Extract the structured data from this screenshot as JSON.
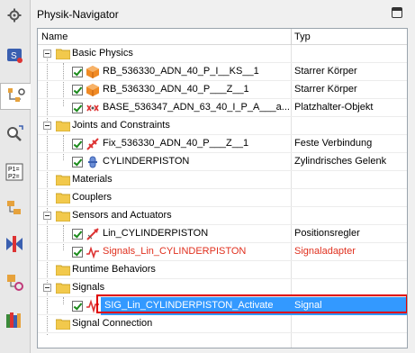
{
  "panel": {
    "title": "Physik-Navigator"
  },
  "tree": {
    "col_name": "Name",
    "col_type": "Typ",
    "rows": [
      {
        "name": "Basic Physics",
        "type": ""
      },
      {
        "name": "RB_536330_ADN_40_P_I__KS__1",
        "type": "Starrer Körper"
      },
      {
        "name": "RB_536330_ADN_40_P___Z__1",
        "type": "Starrer Körper"
      },
      {
        "name": "BASE_536347_ADN_63_40_I_P_A___a...",
        "type": "Platzhalter-Objekt"
      },
      {
        "name": "Joints and Constraints",
        "type": ""
      },
      {
        "name": "Fix_536330_ADN_40_P___Z__1",
        "type": "Feste Verbindung"
      },
      {
        "name": "CYLINDERPISTON",
        "type": "Zylindrisches Gelenk"
      },
      {
        "name": "Materials",
        "type": ""
      },
      {
        "name": "Couplers",
        "type": ""
      },
      {
        "name": "Sensors and Actuators",
        "type": ""
      },
      {
        "name": "Lin_CYLINDERPISTON",
        "type": "Positionsregler"
      },
      {
        "name": "Signals_Lin_CYLINDERPISTON",
        "type": "Signaladapter"
      },
      {
        "name": "Runtime Behaviors",
        "type": ""
      },
      {
        "name": "Signals",
        "type": ""
      },
      {
        "name": "SIG_Lin_CYLINDERPISTON_Activate",
        "type": "Signal"
      },
      {
        "name": "Signal Connection",
        "type": ""
      }
    ]
  },
  "colors": {
    "selection": "#3399ff",
    "highlight_border": "#e00000",
    "adapter_text": "#e0301e"
  },
  "left_toolbar": [
    "settings-icon",
    "signal-icon",
    "physics-navigator-icon",
    "search-icon",
    "p1-p2-icon",
    "assembly-icon",
    "constraint-icon",
    "part-icon",
    "library-icon"
  ]
}
